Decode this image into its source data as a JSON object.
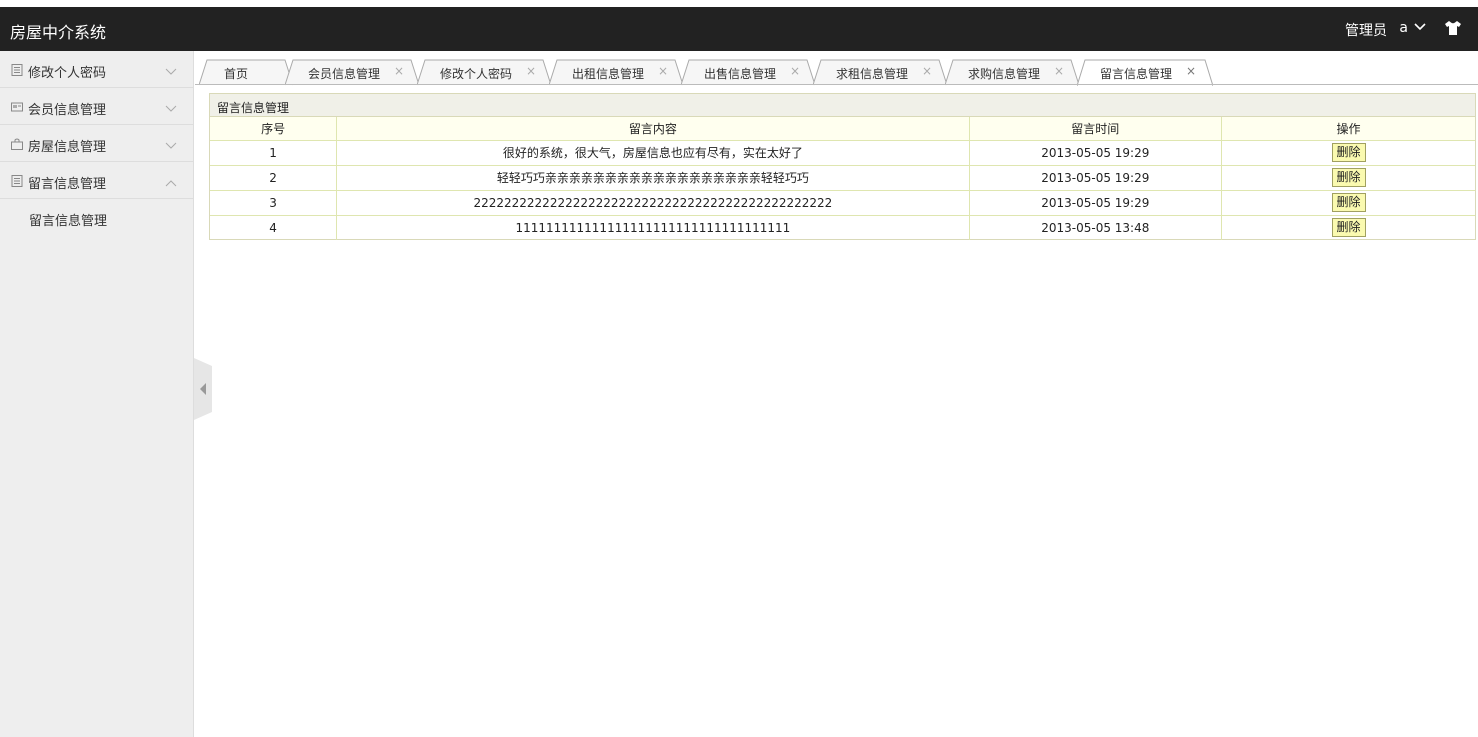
{
  "header": {
    "app_title": "房屋中介系统",
    "role_label": "管理员",
    "username": "a"
  },
  "sidebar": {
    "items": [
      {
        "label": "修改个人密码",
        "icon": "document-icon",
        "expanded": false
      },
      {
        "label": "会员信息管理",
        "icon": "card-icon",
        "expanded": false
      },
      {
        "label": "房屋信息管理",
        "icon": "bag-icon",
        "expanded": false
      },
      {
        "label": "留言信息管理",
        "icon": "document-icon",
        "expanded": true
      }
    ],
    "sub_items": [
      {
        "label": "留言信息管理"
      }
    ]
  },
  "tabs": [
    {
      "label": "首页",
      "closable": false
    },
    {
      "label": "会员信息管理",
      "closable": true
    },
    {
      "label": "修改个人密码",
      "closable": true
    },
    {
      "label": "出租信息管理",
      "closable": true
    },
    {
      "label": "出售信息管理",
      "closable": true
    },
    {
      "label": "求租信息管理",
      "closable": true
    },
    {
      "label": "求购信息管理",
      "closable": true
    },
    {
      "label": "留言信息管理",
      "closable": true,
      "active": true
    }
  ],
  "panel": {
    "title": "留言信息管理",
    "columns": [
      "序号",
      "留言内容",
      "留言时间",
      "操作"
    ],
    "rows": [
      {
        "no": "1",
        "content": "很好的系统，很大气，房屋信息也应有尽有，实在太好了",
        "time": "2013-05-05 19:29",
        "action": "删除"
      },
      {
        "no": "2",
        "content": "轻轻巧巧亲亲亲亲亲亲亲亲亲亲亲亲亲亲亲亲亲亲轻轻巧巧",
        "time": "2013-05-05 19:29",
        "action": "删除"
      },
      {
        "no": "3",
        "content": "22222222222222222222222222222222222222222222222",
        "time": "2013-05-05 19:29",
        "action": "删除"
      },
      {
        "no": "4",
        "content": "111111111111111111111111111111111111",
        "time": "2013-05-05 13:48",
        "action": "删除"
      }
    ]
  },
  "colors": {
    "header_bg": "#222222",
    "sidebar_bg": "#eeeeee",
    "table_border": "#dfe6b0",
    "delete_button_bg": "#fafab0"
  },
  "close_glyph": "×"
}
